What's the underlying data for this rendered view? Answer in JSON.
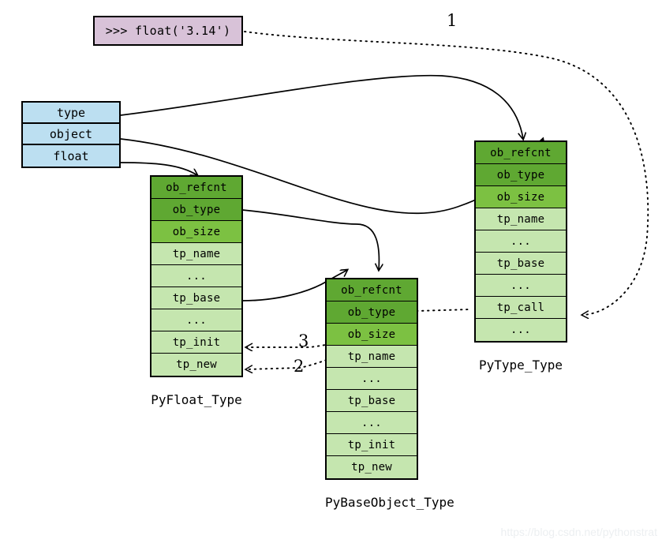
{
  "prompt": {
    "text": ">>> float('3.14')",
    "fill": "#d8c2d8",
    "border": "#000000"
  },
  "name_stack": {
    "fill": "#bcdff1",
    "items": [
      {
        "label": "type"
      },
      {
        "label": "object"
      },
      {
        "label": "float"
      }
    ]
  },
  "colors": {
    "tone_dark": "#5fa832",
    "tone_mid": "#7cc142",
    "tone_light": "#c5e6af",
    "blue": "#bcdff1",
    "purple": "#d8c2d8",
    "stroke": "#000000",
    "watermark": "#eceff1"
  },
  "structs": [
    {
      "id": "pyfloat",
      "caption": "PyFloat_Type",
      "rows": [
        {
          "label": "ob_refcnt",
          "tone": "dark"
        },
        {
          "label": "ob_type",
          "tone": "dark"
        },
        {
          "label": "ob_size",
          "tone": "mid"
        },
        {
          "label": "tp_name",
          "tone": "light"
        },
        {
          "label": "...",
          "tone": "light"
        },
        {
          "label": "tp_base",
          "tone": "light"
        },
        {
          "label": "...",
          "tone": "light"
        },
        {
          "label": "tp_init",
          "tone": "light"
        },
        {
          "label": "tp_new",
          "tone": "light"
        }
      ]
    },
    {
      "id": "pybaseobject",
      "caption": "PyBaseObject_Type",
      "rows": [
        {
          "label": "ob_refcnt",
          "tone": "dark"
        },
        {
          "label": "ob_type",
          "tone": "dark"
        },
        {
          "label": "ob_size",
          "tone": "mid"
        },
        {
          "label": "tp_name",
          "tone": "light"
        },
        {
          "label": "...",
          "tone": "light"
        },
        {
          "label": "tp_base",
          "tone": "light"
        },
        {
          "label": "...",
          "tone": "light"
        },
        {
          "label": "tp_init",
          "tone": "light"
        },
        {
          "label": "tp_new",
          "tone": "light"
        }
      ]
    },
    {
      "id": "pytype",
      "caption": "PyType_Type",
      "rows": [
        {
          "label": "ob_refcnt",
          "tone": "dark"
        },
        {
          "label": "ob_type",
          "tone": "dark"
        },
        {
          "label": "ob_size",
          "tone": "mid"
        },
        {
          "label": "tp_name",
          "tone": "light"
        },
        {
          "label": "...",
          "tone": "light"
        },
        {
          "label": "tp_base",
          "tone": "light"
        },
        {
          "label": "...",
          "tone": "light"
        },
        {
          "label": "tp_call",
          "tone": "light"
        },
        {
          "label": "...",
          "tone": "light"
        }
      ]
    }
  ],
  "steps": [
    {
      "number": "1"
    },
    {
      "number": "3"
    },
    {
      "number": "2"
    }
  ],
  "watermark": {
    "text": "https://blog.csdn.net/pythonstrat"
  }
}
